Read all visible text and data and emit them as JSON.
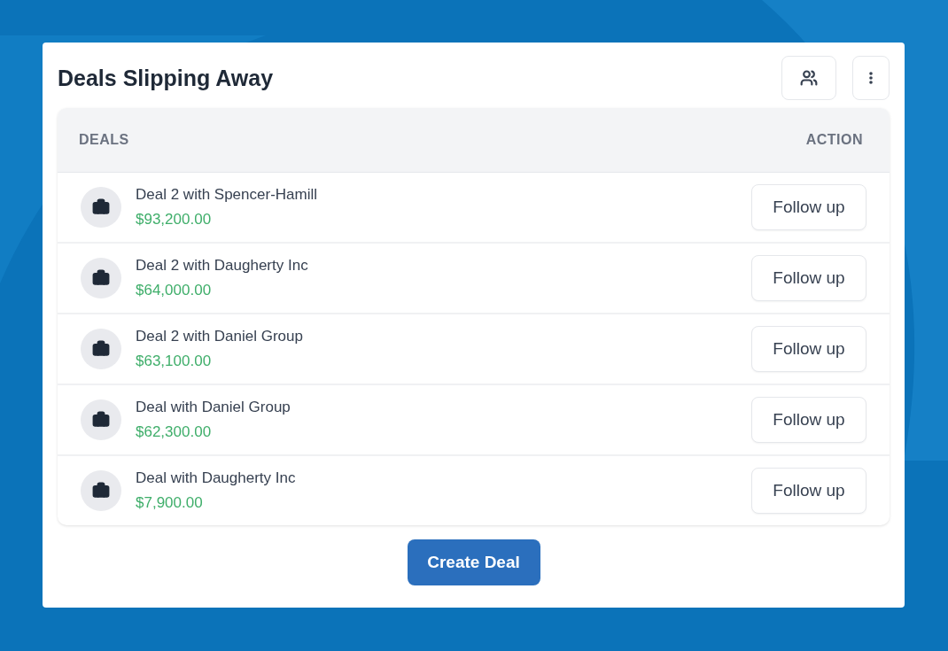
{
  "card": {
    "title": "Deals Slipping Away"
  },
  "table": {
    "columns": [
      "DEALS",
      "ACTION"
    ],
    "rows": [
      {
        "name": "Deal 2 with Spencer-Hamill",
        "amount": "$93,200.00",
        "action": "Follow up"
      },
      {
        "name": "Deal 2 with Daugherty Inc",
        "amount": "$64,000.00",
        "action": "Follow up"
      },
      {
        "name": "Deal 2 with Daniel Group",
        "amount": "$63,100.00",
        "action": "Follow up"
      },
      {
        "name": "Deal with Daniel Group",
        "amount": "$62,300.00",
        "action": "Follow up"
      },
      {
        "name": "Deal with Daugherty Inc",
        "amount": "$7,900.00",
        "action": "Follow up"
      }
    ]
  },
  "footer_button": "Create Deal"
}
